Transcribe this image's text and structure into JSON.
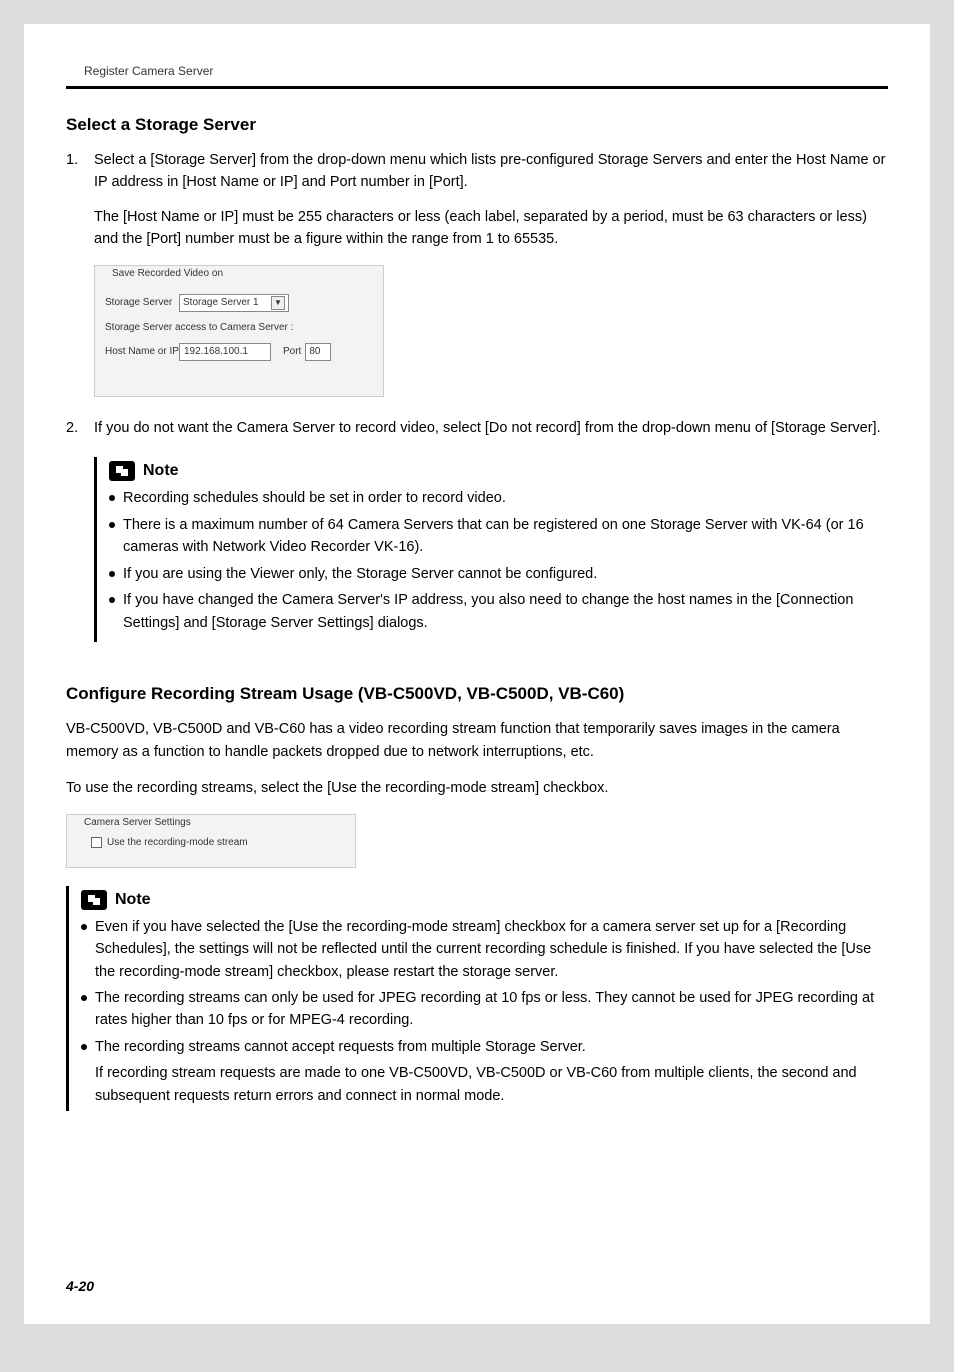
{
  "header": "Register Camera Server",
  "section1": {
    "title": "Select a Storage Server",
    "item1_num": "1.",
    "item1_text": "Select a [Storage Server] from the drop-down menu which lists pre-configured Storage Servers and enter the Host Name or IP address in [Host Name or IP] and Port number in [Port].",
    "item1_para2_a": "The [",
    "item1_para2_b": "Host Name or IP",
    "item1_para2_c": "] must be 255 characters or less (each label, separated by a period, must be 63 characters or less) and the [",
    "item1_para2_d": "Port",
    "item1_para2_e": "] number must be a figure within the range from 1 to 65535.",
    "item2_num": "2.",
    "item2_text": "If you do not want the Camera Server to record video, select [Do not record] from the drop-down menu of [Storage Server]."
  },
  "figure1": {
    "legend": "Save Recorded Video on",
    "storage_server_label": "Storage Server",
    "storage_server_value": "Storage Server 1",
    "access_text": "Storage Server access to Camera Server :",
    "host_label": "Host Name or IP",
    "host_value": "192.168.100.1",
    "port_label": "Port",
    "port_value": "80"
  },
  "note1": {
    "title": "Note",
    "b1": "Recording schedules should be set in order to record video.",
    "b2": "There is a maximum number of 64 Camera Servers that can be registered on one Storage Server with VK-64 (or 16 cameras with Network Video Recorder VK-16).",
    "b3": "If you are using the Viewer only, the Storage Server cannot be configured.",
    "b4_a": "If you have changed the Camera Server's IP address, you also need to change the host names in the [",
    "b4_b": "Connection Settings",
    "b4_c": "] and [",
    "b4_d": "Storage Server Settings",
    "b4_e": "] dialogs."
  },
  "section2": {
    "title": "Configure Recording Stream Usage (VB-C500VD, VB-C500D, VB-C60)",
    "para1": "VB-C500VD, VB-C500D and VB-C60 has a video recording stream function that temporarily saves images in the camera memory as a function to handle packets dropped due to network interruptions, etc.",
    "para2_a": "To use the recording streams, select the [",
    "para2_b": "Use the recording-mode stream",
    "para2_c": "] checkbox."
  },
  "figure2": {
    "legend": "Camera Server Settings",
    "checkbox_label": "Use the recording-mode stream"
  },
  "note2": {
    "title": "Note",
    "b1_a": "Even if you have selected the [",
    "b1_b": "Use the recording-mode stream",
    "b1_c": "] checkbox for a camera server set up for a [",
    "b1_d": "Recording Schedules",
    "b1_e": "], the settings will not be reflected until the current recording schedule is finished. If you have selected the [",
    "b1_f": "Use the recording-mode stream",
    "b1_g": "] checkbox, please restart the storage server.",
    "b2": "The recording streams can only be used for JPEG recording at 10 fps or less. They cannot be used for JPEG recording at rates higher than 10 fps or for MPEG-4 recording.",
    "b3_line1": "The recording streams cannot accept requests from multiple Storage Server.",
    "b3_line2": "If recording stream requests are made to one VB-C500VD, VB-C500D or VB-C60 from multiple clients, the second and subsequent requests return errors and connect in normal mode."
  },
  "page_number": "4-20"
}
